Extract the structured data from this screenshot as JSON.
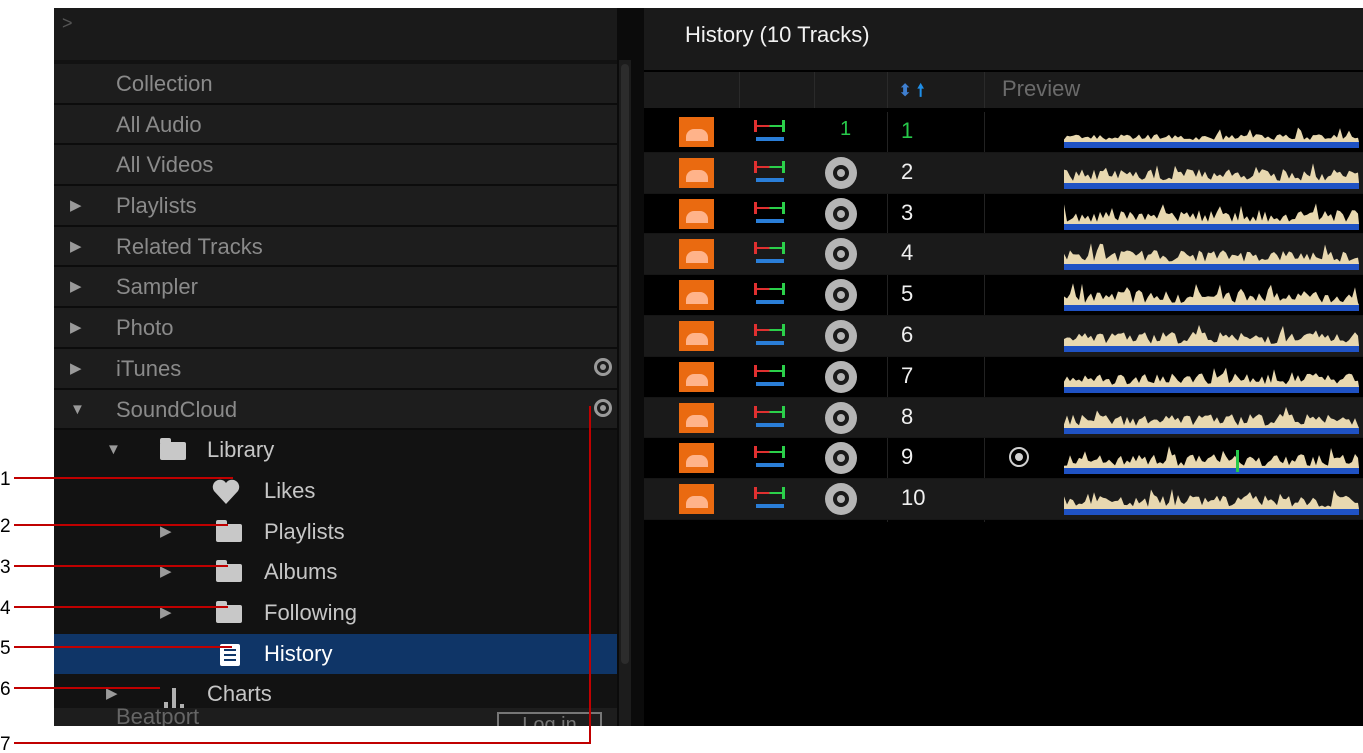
{
  "left_panel": {
    "items": [
      {
        "label": "Collection",
        "indent": 0,
        "arrow": "",
        "band": true
      },
      {
        "label": "All Audio",
        "indent": 0,
        "arrow": "",
        "band": true
      },
      {
        "label": "All Videos",
        "indent": 0,
        "arrow": "",
        "band": true
      },
      {
        "label": "Playlists",
        "indent": 0,
        "arrow": "▶",
        "band": true
      },
      {
        "label": "Related Tracks",
        "indent": 0,
        "arrow": "▶",
        "band": true
      },
      {
        "label": "Sampler",
        "indent": 0,
        "arrow": "▶",
        "band": true
      },
      {
        "label": "Photo",
        "indent": 0,
        "arrow": "▶",
        "band": true
      },
      {
        "label": "iTunes",
        "indent": 0,
        "arrow": "▶",
        "band": true
      },
      {
        "label": "SoundCloud",
        "indent": 0,
        "arrow": "▼",
        "band": true
      }
    ],
    "soundcloud_tree": {
      "library": "Library",
      "library_arrow": "▼",
      "likes": "Likes",
      "playlists": "Playlists",
      "albums": "Albums",
      "following": "Following",
      "history": "History",
      "charts": "Charts",
      "expand_arrow": "▶"
    },
    "beatport_label": "Beatport",
    "login_label": "Log in"
  },
  "right_panel": {
    "title": "History (10 Tracks)",
    "preview_header": "Preview",
    "tracks": [
      {
        "num": "1",
        "key": "1",
        "flag": false
      },
      {
        "num": "2",
        "key": "",
        "flag": false
      },
      {
        "num": "3",
        "key": "",
        "flag": false
      },
      {
        "num": "4",
        "key": "",
        "flag": false
      },
      {
        "num": "5",
        "key": "",
        "flag": false
      },
      {
        "num": "6",
        "key": "",
        "flag": false
      },
      {
        "num": "7",
        "key": "",
        "flag": false
      },
      {
        "num": "8",
        "key": "",
        "flag": false
      },
      {
        "num": "9",
        "key": "",
        "flag": true
      },
      {
        "num": "10",
        "key": "",
        "flag": false
      }
    ]
  },
  "callouts": {
    "labels": [
      "1",
      "2",
      "3",
      "4",
      "5",
      "6",
      "7"
    ],
    "line_color": "#c00000"
  },
  "colors": {
    "selected": "#0f3567",
    "soundcloud_orange": "#ea6a10",
    "waveform_blue": "#1f52c4",
    "waveform_cream": "#e8d8b0",
    "key_green": "#27c94a"
  }
}
